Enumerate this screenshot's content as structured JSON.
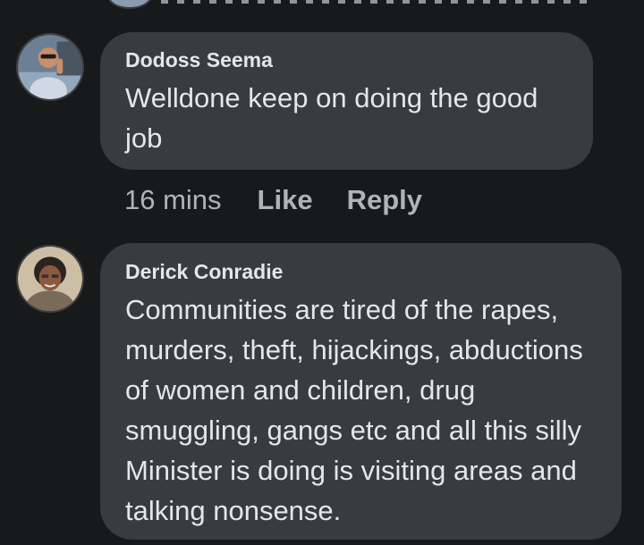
{
  "comments": [
    {
      "author": "Dodoss Seema",
      "text": "Welldone keep on doing the good job",
      "time": "16 mins",
      "like_label": "Like",
      "reply_label": "Reply"
    },
    {
      "author": "Derick Conradie",
      "text": "Communities are tired of the rapes, murders, theft, hijackings, abductions of women and children, drug smuggling, gangs etc and all this silly Minister is doing is visiting areas and talking nonsense."
    }
  ],
  "icons": {
    "avatar_1": "avatar-photo-man-sunglasses",
    "avatar_2": "avatar-photo-woman"
  },
  "colors": {
    "background": "#18191a",
    "bubble": "#3a3b3c",
    "text_primary": "#e4e6eb",
    "text_secondary": "#b0b3b8"
  }
}
